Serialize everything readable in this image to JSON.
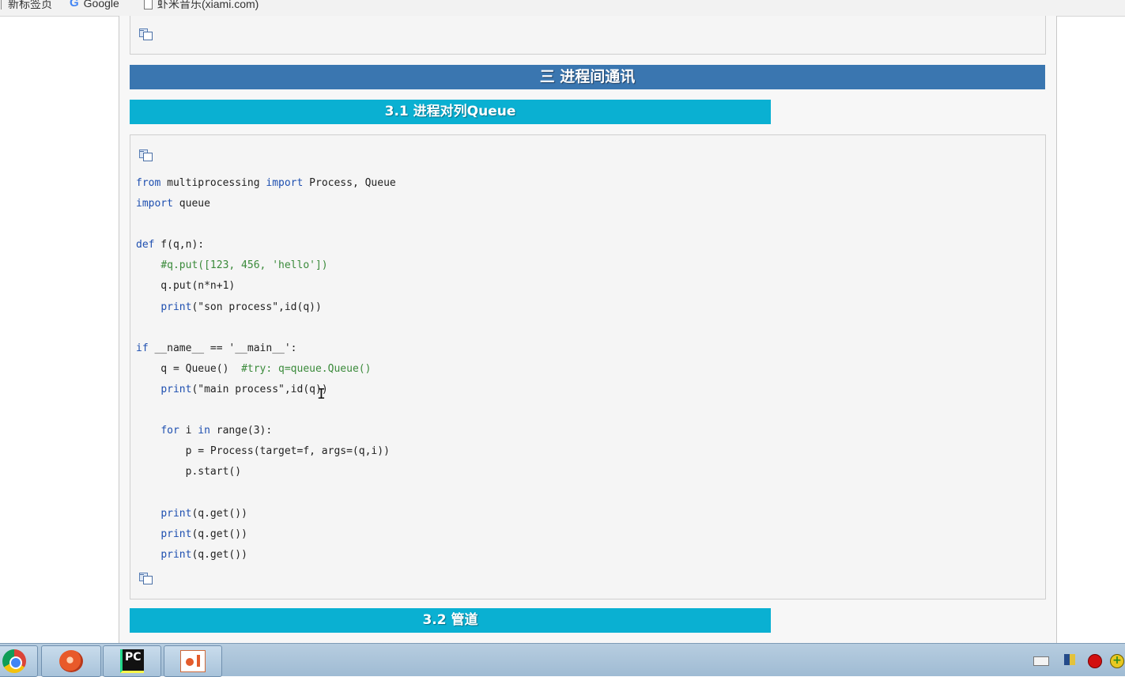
{
  "bookmarks": {
    "items": [
      {
        "label": "新标签页",
        "icon": "bookmark-bar-icon"
      },
      {
        "label": "Google",
        "icon": "google-icon"
      },
      {
        "label": "虾米音乐(xiami.com)",
        "icon": "page-icon"
      }
    ]
  },
  "section": {
    "title": "三 进程间通讯"
  },
  "subsections": [
    {
      "title": "3.1 进程对列Queue"
    },
    {
      "title": "3.2 管道"
    }
  ],
  "code_block": {
    "lines": [
      "from multiprocessing import Process, Queue",
      "import queue",
      "",
      "def f(q,n):",
      "    #q.put([123, 456, 'hello'])",
      "    q.put(n*n+1)",
      "    print(\"son process\",id(q))",
      "",
      "if __name__ == '__main__':",
      "    q = Queue()  #try: q=queue.Queue()",
      "    print(\"main process\",id(q))",
      "",
      "    for i in range(3):",
      "        p = Process(target=f, args=(q,i))",
      "        p.start()",
      "",
      "    print(q.get())",
      "    print(q.get())",
      "    print(q.get())"
    ]
  },
  "taskbar": {
    "apps": [
      {
        "name": "chrome",
        "icon": "chrome-icon"
      },
      {
        "name": "snail",
        "icon": "snail-icon"
      },
      {
        "name": "pycharm",
        "icon": "pycharm-icon",
        "label": "PC"
      },
      {
        "name": "powerpoint",
        "icon": "powerpoint-icon"
      }
    ],
    "tray": [
      "keyboard-icon",
      "language-flag-icon",
      "record-icon",
      "add-icon"
    ]
  },
  "colors": {
    "section_header": "#3a76b0",
    "subsection_header": "#0ab0d2",
    "keyword": "#1e4fb0",
    "comment": "#3a8a3a"
  }
}
